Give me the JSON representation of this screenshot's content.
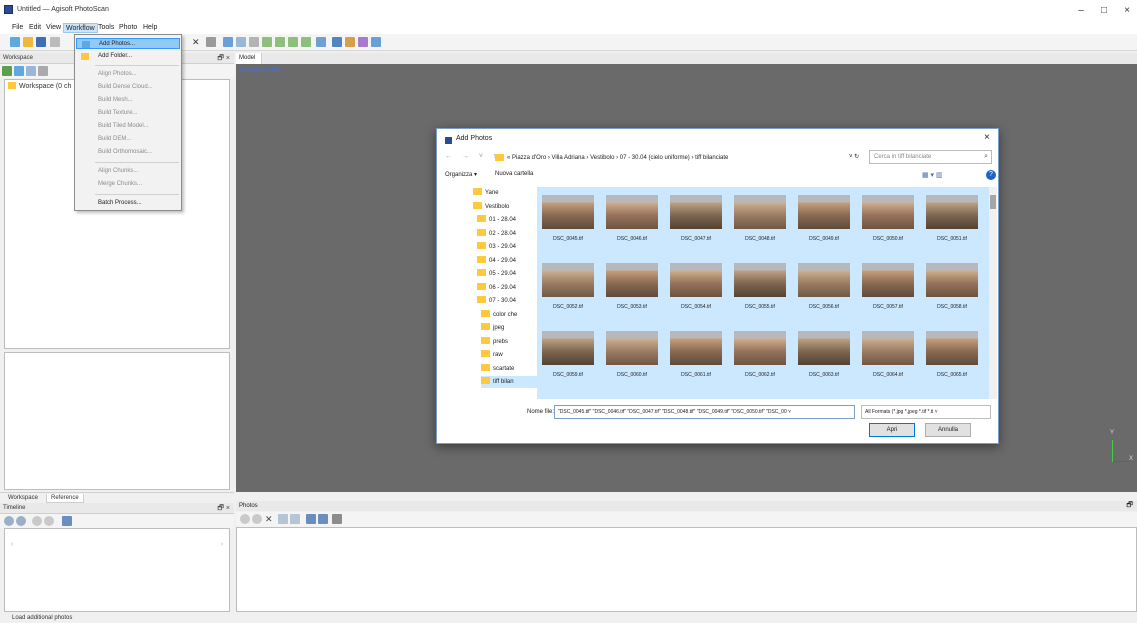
{
  "window": {
    "title": "Untitled — Agisoft PhotoScan",
    "minimize": "–",
    "maximize": "□",
    "close": "×"
  },
  "menubar": [
    "File",
    "Edit",
    "View",
    "Workflow",
    "Tools",
    "Photo",
    "Help"
  ],
  "workflow_menu": {
    "items": [
      {
        "label": "Add Photos...",
        "state": "hover"
      },
      {
        "label": "Add Folder...",
        "state": "enabled"
      },
      {
        "label": "Align Photos...",
        "state": "disabled"
      },
      {
        "label": "Build Dense Cloud...",
        "state": "disabled"
      },
      {
        "label": "Build Mesh...",
        "state": "disabled"
      },
      {
        "label": "Build Texture...",
        "state": "disabled"
      },
      {
        "label": "Build Tiled Model...",
        "state": "disabled"
      },
      {
        "label": "Build DEM...",
        "state": "disabled"
      },
      {
        "label": "Build Orthomosaic...",
        "state": "disabled"
      },
      {
        "label": "Align Chunks...",
        "state": "disabled"
      },
      {
        "label": "Merge Chunks...",
        "state": "disabled"
      },
      {
        "label": "Batch Process...",
        "state": "enabled"
      }
    ]
  },
  "workspace": {
    "header": "Workspace",
    "controls": "🗗 ×",
    "root": "Workspace (0 ch"
  },
  "bottom_tabs": [
    "Workspace",
    "Reference"
  ],
  "timeline": {
    "header": "Timeline",
    "controls": "🗗 ×",
    "scroll_left": "‹",
    "scroll_right": "›"
  },
  "model": {
    "tab": "Model",
    "view_label": "Perspective 30°",
    "axis_y": "Y",
    "axis_x": "X"
  },
  "photos_panel": {
    "header": "Photos",
    "control": "🗗"
  },
  "status": "Load additional photos",
  "dialog": {
    "title": "Add Photos",
    "close": "×",
    "nav_arrows": "← → ˅ ↑",
    "path": "« Piazza d'Oro › Villa Adriana › Vestibolo › 07 - 30.04 (cielo uniforme) › tiff bilanciate",
    "path_controls": "˅ ↻",
    "search_placeholder": "Cerca in tiff bilanciate",
    "search_icon": "⌕",
    "organize": "Organizza ▾",
    "new_folder": "Nuova cartella",
    "view_icons": "▦ ▾  ▥",
    "help": "?",
    "nav_items": [
      {
        "label": "Yane",
        "indent": 1
      },
      {
        "label": "Vestibolo",
        "indent": 1
      },
      {
        "label": "01 - 28.04",
        "indent": 2
      },
      {
        "label": "02 - 28.04",
        "indent": 2
      },
      {
        "label": "03 - 29.04",
        "indent": 2
      },
      {
        "label": "04 - 29.04",
        "indent": 2
      },
      {
        "label": "05 - 29.04",
        "indent": 2
      },
      {
        "label": "06 - 29.04",
        "indent": 2
      },
      {
        "label": "07 - 30.04",
        "indent": 2
      },
      {
        "label": "color che",
        "indent": 3
      },
      {
        "label": "jpeg",
        "indent": 3
      },
      {
        "label": "prebs",
        "indent": 3
      },
      {
        "label": "raw",
        "indent": 3
      },
      {
        "label": "scartate",
        "indent": 3
      },
      {
        "label": "tiff bilan",
        "indent": 3,
        "selected": true
      }
    ],
    "files": [
      "DSC_0045.tif",
      "DSC_0046.tif",
      "DSC_0047.tif",
      "DSC_0048.tif",
      "DSC_0049.tif",
      "DSC_0050.tif",
      "DSC_0051.tif",
      "DSC_0052.tif",
      "DSC_0053.tif",
      "DSC_0054.tif",
      "DSC_0055.tif",
      "DSC_0056.tif",
      "DSC_0057.tif",
      "DSC_0058.tif",
      "DSC_0059.tif",
      "DSC_0060.tif",
      "DSC_0061.tif",
      "DSC_0062.tif",
      "DSC_0063.tif",
      "DSC_0064.tif",
      "DSC_0065.tif"
    ],
    "filename_label": "Nome file:",
    "filename_value": "\"DSC_0045.tif\" \"DSC_0046.tif\" \"DSC_0047.tif\" \"DSC_0048.tif\" \"DSC_0049.tif\" \"DSC_0050.tif\" \"DSC_00 ˅",
    "filter": "All Formats (*.jpg *.jpeg *.tif *.ti ˅",
    "open": "Apri",
    "cancel": "Annulla"
  }
}
